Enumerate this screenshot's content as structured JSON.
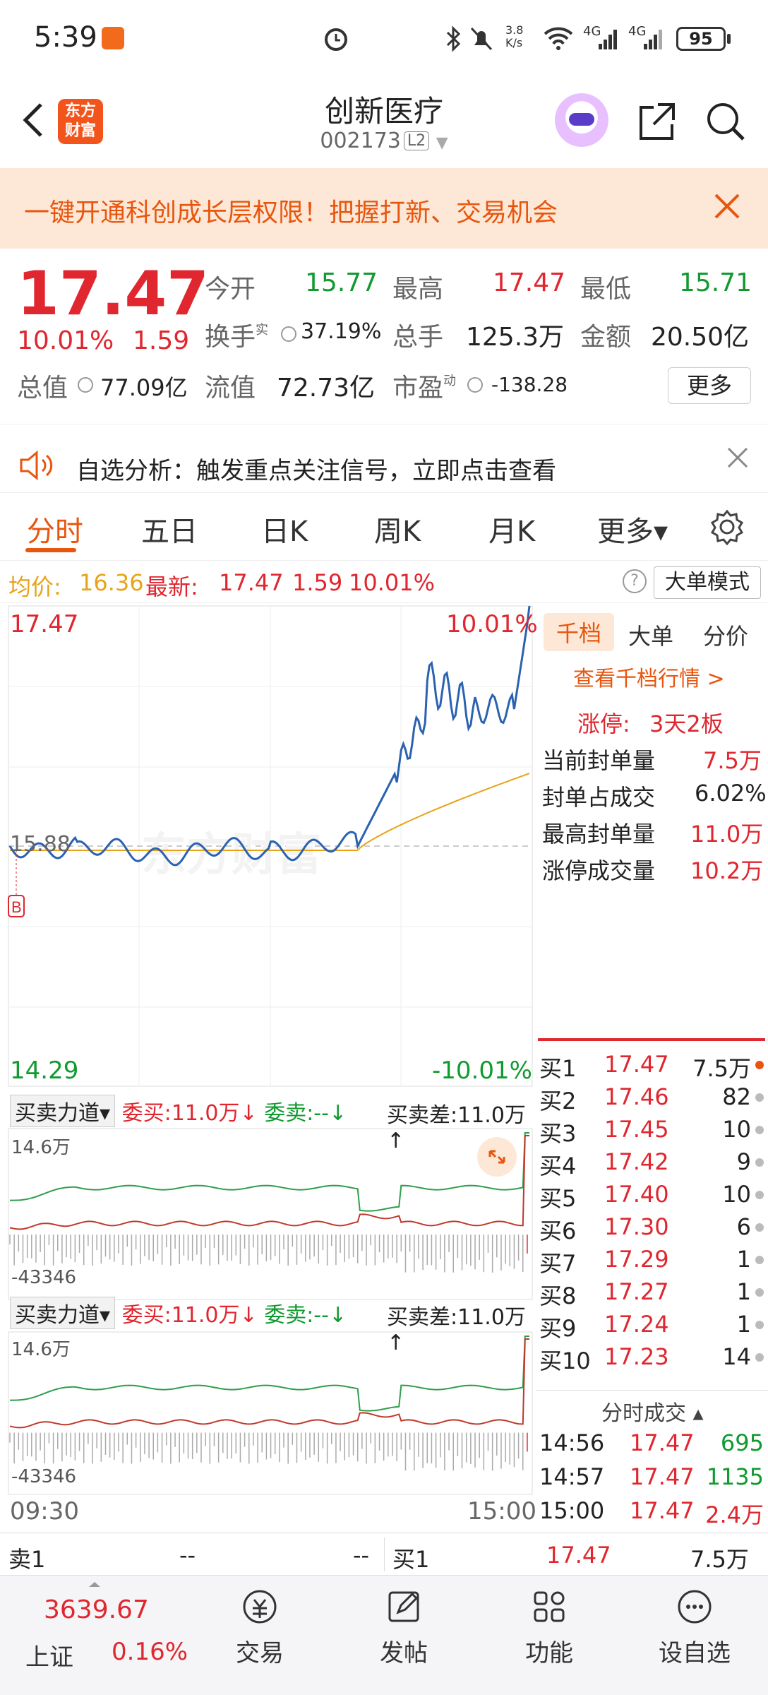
{
  "status": {
    "time": "5:39",
    "net_speed": "3.8\nK/s",
    "battery": "95",
    "sig1": "4G",
    "sig2": "4G"
  },
  "nav": {
    "logo_text": "东方\n财富",
    "title": "创新医疗",
    "code": "002173",
    "level": "L2"
  },
  "banner": {
    "text": "一键开通科创成长层权限！把握打新、交易机会"
  },
  "quote": {
    "price": "17.47",
    "change_pct": "10.01%",
    "change": "1.59",
    "open_label": "今开",
    "open": "15.77",
    "high_label": "最高",
    "high": "17.47",
    "low_label": "最低",
    "low": "15.71",
    "turnover_label": "换手",
    "turnover_sup": "实",
    "turnover": "37.19%",
    "volume_label": "总手",
    "volume": "125.3万",
    "amount_label": "金额",
    "amount": "20.50亿",
    "mcap_label": "总值",
    "mcap": "77.09亿",
    "float_label": "流值",
    "float": "72.73亿",
    "pe_label": "市盈",
    "pe_sup": "动",
    "pe": "-138.28",
    "more": "更多"
  },
  "alert": {
    "text": "自选分析：触发重点关注信号，立即点击查看"
  },
  "tabs": [
    "分时",
    "五日",
    "日K",
    "周K",
    "月K",
    "更多▾"
  ],
  "infobar": {
    "avg_label": "均价:",
    "avg": "16.36",
    "last_label": "最新:",
    "last": "17.47",
    "chg": "1.59",
    "pct": "10.01%",
    "help": "?",
    "mode_btn": "大单模式"
  },
  "chart": {
    "top_price": "17.47",
    "top_pct": "10.01%",
    "mid_price": "15.88",
    "bottom_price": "14.29",
    "bottom_pct": "-10.01%",
    "marker": "B",
    "flow_sel": "买卖力道▾",
    "buy_label": "委买:11.0万↓",
    "sell_label": "委卖:--↓",
    "diff_label": "买卖差:11.0万↑",
    "flow_max": "14.6万",
    "flow_min": "-43346",
    "time_start": "09:30",
    "time_end": "15:00",
    "watermark": "东方财富"
  },
  "right": {
    "tabs": [
      "千档",
      "大单",
      "分价"
    ],
    "link": "查看千档行情 >",
    "limit_label": "涨停:",
    "limit_value": "3天2板",
    "rows": [
      {
        "label": "当前封单量",
        "value": "7.5万"
      },
      {
        "label": "封单占成交",
        "value": "6.02%"
      },
      {
        "label": "最高封单量",
        "value": "11.0万"
      },
      {
        "label": "涨停成交量",
        "value": "10.2万"
      }
    ],
    "bids": [
      {
        "n": "买1",
        "p": "17.47",
        "v": "7.5万"
      },
      {
        "n": "买2",
        "p": "17.46",
        "v": "82"
      },
      {
        "n": "买3",
        "p": "17.45",
        "v": "10"
      },
      {
        "n": "买4",
        "p": "17.42",
        "v": "9"
      },
      {
        "n": "买5",
        "p": "17.40",
        "v": "10"
      },
      {
        "n": "买6",
        "p": "17.30",
        "v": "6"
      },
      {
        "n": "买7",
        "p": "17.29",
        "v": "1"
      },
      {
        "n": "买8",
        "p": "17.27",
        "v": "1"
      },
      {
        "n": "买9",
        "p": "17.24",
        "v": "1"
      },
      {
        "n": "买10",
        "p": "17.23",
        "v": "14"
      }
    ],
    "trades_title": "分时成交 ▴",
    "trades": [
      {
        "t": "14:56",
        "p": "17.47",
        "v": "695"
      },
      {
        "t": "14:57",
        "p": "17.47",
        "v": "1135"
      },
      {
        "t": "15:00",
        "p": "17.47",
        "v": "2.4万"
      }
    ]
  },
  "bottom_quote": {
    "sell_label": "卖1",
    "sell_p": "--",
    "sell_v": "--",
    "buy_label": "买1",
    "buy_p": "17.47",
    "buy_v": "7.5万"
  },
  "bottom_nav": {
    "index_value": "3639.67",
    "index_name": "上证",
    "index_pct": "0.16%",
    "items": [
      "交易",
      "发帖",
      "功能",
      "设自选"
    ]
  }
}
